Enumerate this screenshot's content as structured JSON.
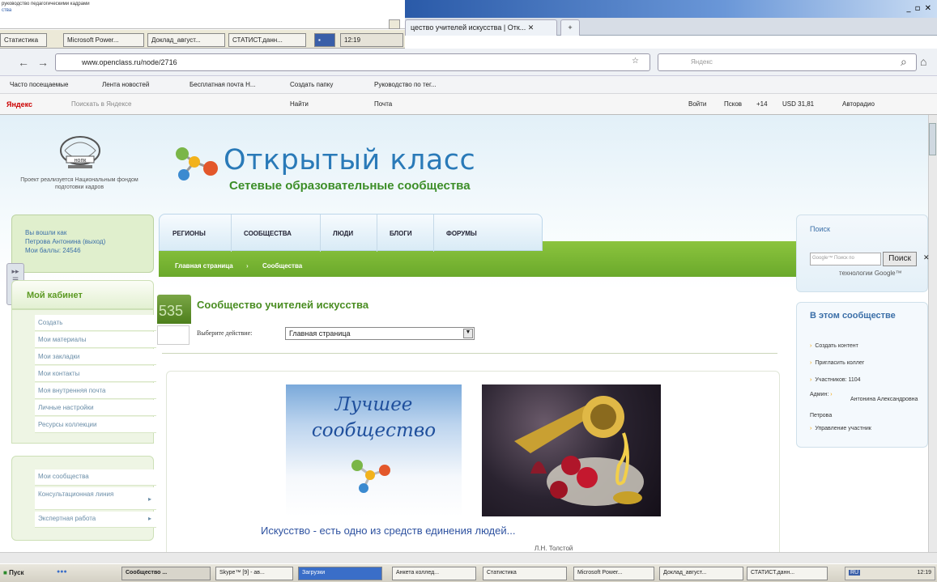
{
  "old_window": {
    "fragment_text_1": "руководство педагогическими кадрами",
    "fragment_text_2": "ства",
    "taskbar_items": [
      "Статистика",
      "Microsoft Power...",
      "Доклад_август...",
      "СТАТИСТ.данн..."
    ],
    "clock": "12:19"
  },
  "browser": {
    "window_controls": "_ ▫ ✕",
    "tab_label": "цество учителей искусства | Отк...",
    "new_tab": "+",
    "url": "www.openclass.ru/node/2716",
    "search_placeholder": "Яндекс",
    "bookmarks": [
      "Часто посещаемые",
      "Лента новостей",
      "Бесплатная почта H...",
      "Создать папку",
      "Руководство по тег..."
    ],
    "yandex_label": "Яндекс",
    "yandex_search": "Поискать в Яндексе",
    "yandex_find": "Найти",
    "yandex_mail": "Почта",
    "yandex_login": "Войти",
    "yandex_weather": "Псков",
    "yandex_temp": "+14",
    "yandex_usd": "USD 31,81",
    "yandex_avto": "Авторадио"
  },
  "site": {
    "logo_text": "нопк",
    "logo_caption": "Проект реализуется Национальным фондом подготовки кадров",
    "title": "Открытый класс",
    "subtitle": "Сетевые образовательные сообщества",
    "login": {
      "line1": "Вы вошли как",
      "line2": "Петрова Антонина (выход)",
      "line3": "Мои баллы: 24546"
    },
    "menu": [
      "РЕГИОНЫ",
      "СООБЩЕСТВА",
      "ЛЮДИ",
      "БЛОГИ",
      "ФОРУМЫ"
    ],
    "breadcrumb": [
      "Главная страница",
      "Сообщества"
    ],
    "cabinet_title": "Мой кабинет",
    "cabinet_items": [
      "Создать",
      "Мои материалы",
      "Мои закладки",
      "Мои контакты",
      "Моя внутренняя почта",
      "Личные настройки",
      "Ресурсы коллекции"
    ],
    "community_items": [
      "Мои сообщества",
      "Консультационная линия",
      "Экспертная работа"
    ],
    "member_count": "535",
    "community_title": "Сообщество учителей искусства",
    "action_label": "Выберите действие:",
    "action_value": "Главная страница",
    "best_community": "Лучшее сообщество",
    "quote": "Искусство - есть одно из средств единения людей...",
    "quote_author": "Л.Н. Толстой",
    "search_title": "Поиск",
    "search_placeholder": "Google™ Поиск по",
    "search_button": "Поиск",
    "search_tech": "технологии Google™",
    "in_community_title": "В этом сообществе",
    "in_community_items": [
      "Создать контент",
      "Пригласить коллег",
      "Участников: 1104"
    ],
    "admin_label": "Админ:",
    "admin_name": "Антонина Александровна Петрова",
    "manage_members": "Управление участник"
  },
  "taskbar": {
    "start": "Пуск",
    "items": [
      "Сообщество ...",
      "Skype™ [9] - ав...",
      "Загрузки",
      "Анкета коллед...",
      "Статистика",
      "Microsoft Power...",
      "Доклад_август...",
      "СТАТИСТ.данн..."
    ],
    "lang": "RU",
    "clock": "12:19"
  },
  "colors": {
    "accent_green": "#6aa92b",
    "title_blue": "#2a7ab8",
    "link_blue": "#3b6fa8"
  }
}
